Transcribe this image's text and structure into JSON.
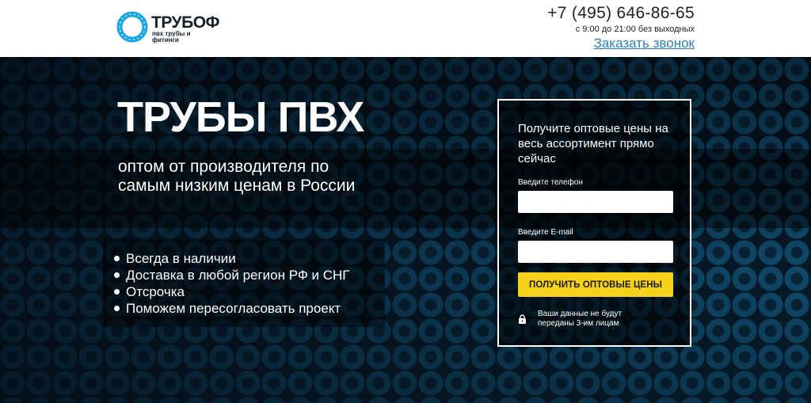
{
  "header": {
    "logo": {
      "title": "ТРУБОФ",
      "subtitle": "пвх трубы и фитинги"
    },
    "phone": "+7 (495) 646-86-65",
    "hours": "с 9:00 до 21:00 без выходных",
    "callback_label": "Заказать звонок"
  },
  "hero": {
    "title": "ТРУБЫ ПВХ",
    "subtitle": "оптом от производителя по самым низким ценам в России",
    "benefits": [
      "Всегда в наличии",
      "Доставка в любой регион РФ и СНГ",
      "Отсрочка",
      "Поможем пересогласовать проект"
    ]
  },
  "form": {
    "heading": "Получите оптовые цены на весь ассортимент прямо сейчас",
    "phone_label": "Введите телефон",
    "phone_value": "",
    "email_label": "Введите E-mail",
    "email_value": "",
    "submit_label": "ПОЛУЧИТЬ ОПТОВЫЕ ЦЕНЫ",
    "privacy_text": "Ваши данные не будут переданы 3-им лицам"
  },
  "colors": {
    "accent_yellow": "#f7d21d",
    "link_blue": "#2f7fb2",
    "logo_blue": "#1ba6e0",
    "dark_text": "#16202a"
  },
  "icons": {
    "logo": "ring-logo-icon",
    "privacy": "lock-icon"
  }
}
